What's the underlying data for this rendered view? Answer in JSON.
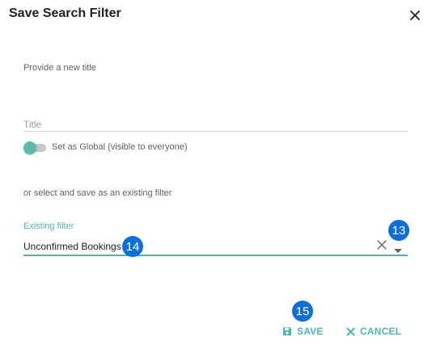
{
  "dialog": {
    "title": "Save Search Filter",
    "prompt": "Provide a new title",
    "title_placeholder": "Title",
    "title_value": "",
    "global_toggle_label": "Set as Global (visible to everyone)",
    "or_text": "or select and save as an existing filter",
    "existing_filter": {
      "label": "Existing filter",
      "value": "Unconfirmed Bookings"
    },
    "buttons": {
      "save": "SAVE",
      "cancel": "CANCEL"
    }
  },
  "badges": {
    "b13": "13",
    "b14": "14",
    "b15": "15"
  },
  "colors": {
    "accent": "#4db6ac",
    "badge": "#0e6fd8"
  },
  "icons": [
    "close-icon",
    "clear-icon",
    "chevron-down-icon",
    "save-icon",
    "cancel-icon"
  ]
}
